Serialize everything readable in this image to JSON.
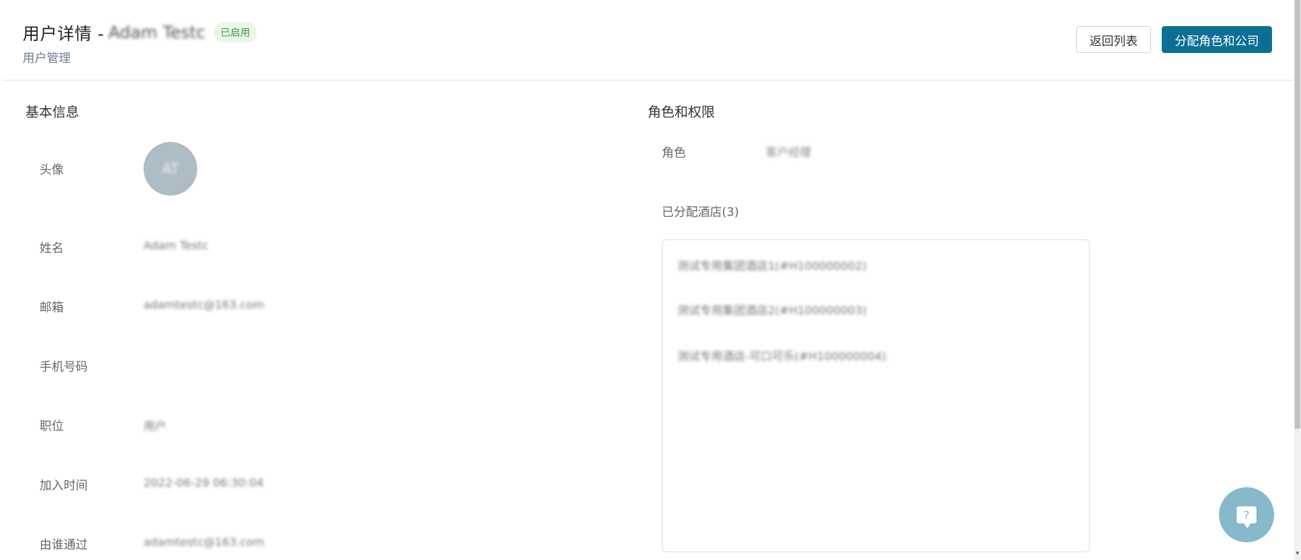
{
  "header": {
    "title": "用户详情 -",
    "user_name": "Adam Testc",
    "status": "已启用",
    "breadcrumb": "用户管理",
    "back_label": "返回列表",
    "assign_label": "分配角色和公司"
  },
  "basic_info": {
    "title": "基本信息",
    "avatar_label": "头像",
    "avatar_initials": "AT",
    "fields": [
      {
        "label": "姓名",
        "value": "Adam Testc"
      },
      {
        "label": "邮箱",
        "value": "adamtestc@163.com"
      },
      {
        "label": "手机号码",
        "value": ""
      },
      {
        "label": "职位",
        "value": "用户"
      },
      {
        "label": "加入时间",
        "value": "2022-06-29 06:30:04"
      },
      {
        "label": "由谁通过",
        "value": "adamtestc@163.com"
      }
    ]
  },
  "roles": {
    "title": "角色和权限",
    "role_label": "角色",
    "role_value": "客户经理",
    "hotels_label": "已分配酒店(3)",
    "hotels": [
      "测试专用集团酒店1(#H100000002)",
      "测试专用集团酒店2(#H100000003)",
      "测试专用酒店-可口可乐(#H100000004)"
    ]
  },
  "help": {
    "icon_text": "?"
  },
  "colors": {
    "primary": "#0d6f93",
    "status_text": "#3a9d45",
    "status_bg": "#eaf6e9",
    "avatar_bg": "#aebcc5",
    "help_bg": "#86b9cb"
  }
}
